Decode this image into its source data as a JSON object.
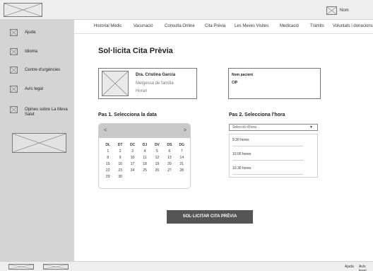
{
  "header": {
    "user_label": "Nom"
  },
  "sidebar": {
    "items": [
      {
        "label": "Ajuda"
      },
      {
        "label": "Idioma"
      },
      {
        "label": "Centre d'urgències"
      },
      {
        "label": "Avís legal"
      },
      {
        "label": "Opineu sobre La Meva Salut"
      }
    ]
  },
  "nav": {
    "items": [
      {
        "label": "Historial Mèdic"
      },
      {
        "label": "Vacunació"
      },
      {
        "label": "Consulta Online"
      },
      {
        "label": "Cita Prèvia"
      },
      {
        "label": "Les Meves Visites"
      },
      {
        "label": "Medicació"
      },
      {
        "label": "Tràmits"
      },
      {
        "label": "Voluntats i donacions"
      }
    ]
  },
  "main": {
    "title": "Sol·licita Cita Prèvia",
    "doctor": {
      "name": "Dra. Cristina Garcia",
      "specialty": "Metgessa de família",
      "schedule": "Horari"
    },
    "patient": {
      "name_label": "Nom pacient",
      "cip_label": "CIP"
    },
    "step1": "Pas 1. Selecciona la data",
    "step2": "Pas 2. Selecciona l'hora",
    "calendar": {
      "prev": "<",
      "next": ">",
      "weekdays": [
        "DL",
        "DT",
        "DC",
        "DJ",
        "DV",
        "DS",
        "DG"
      ],
      "weeks": [
        [
          "1",
          "2",
          "3",
          "4",
          "5",
          "6",
          "7"
        ],
        [
          "8",
          "9",
          "10",
          "11",
          "12",
          "13",
          "14"
        ],
        [
          "15",
          "16",
          "17",
          "18",
          "19",
          "20",
          "21"
        ],
        [
          "22",
          "23",
          "24",
          "25",
          "26",
          "27",
          "28"
        ],
        [
          "29",
          "30",
          "",
          "",
          "",
          "",
          ""
        ]
      ]
    },
    "hour_select": {
      "label": "Selecció d'hora",
      "caret": "▼"
    },
    "hours": [
      "9.30 hores",
      "10.00 hores",
      "10.30 hores"
    ],
    "submit_label": "SOL·LICITAR CITA PRÈVIA"
  },
  "footer": {
    "links": [
      "Ajuda",
      "Avís legal"
    ]
  }
}
